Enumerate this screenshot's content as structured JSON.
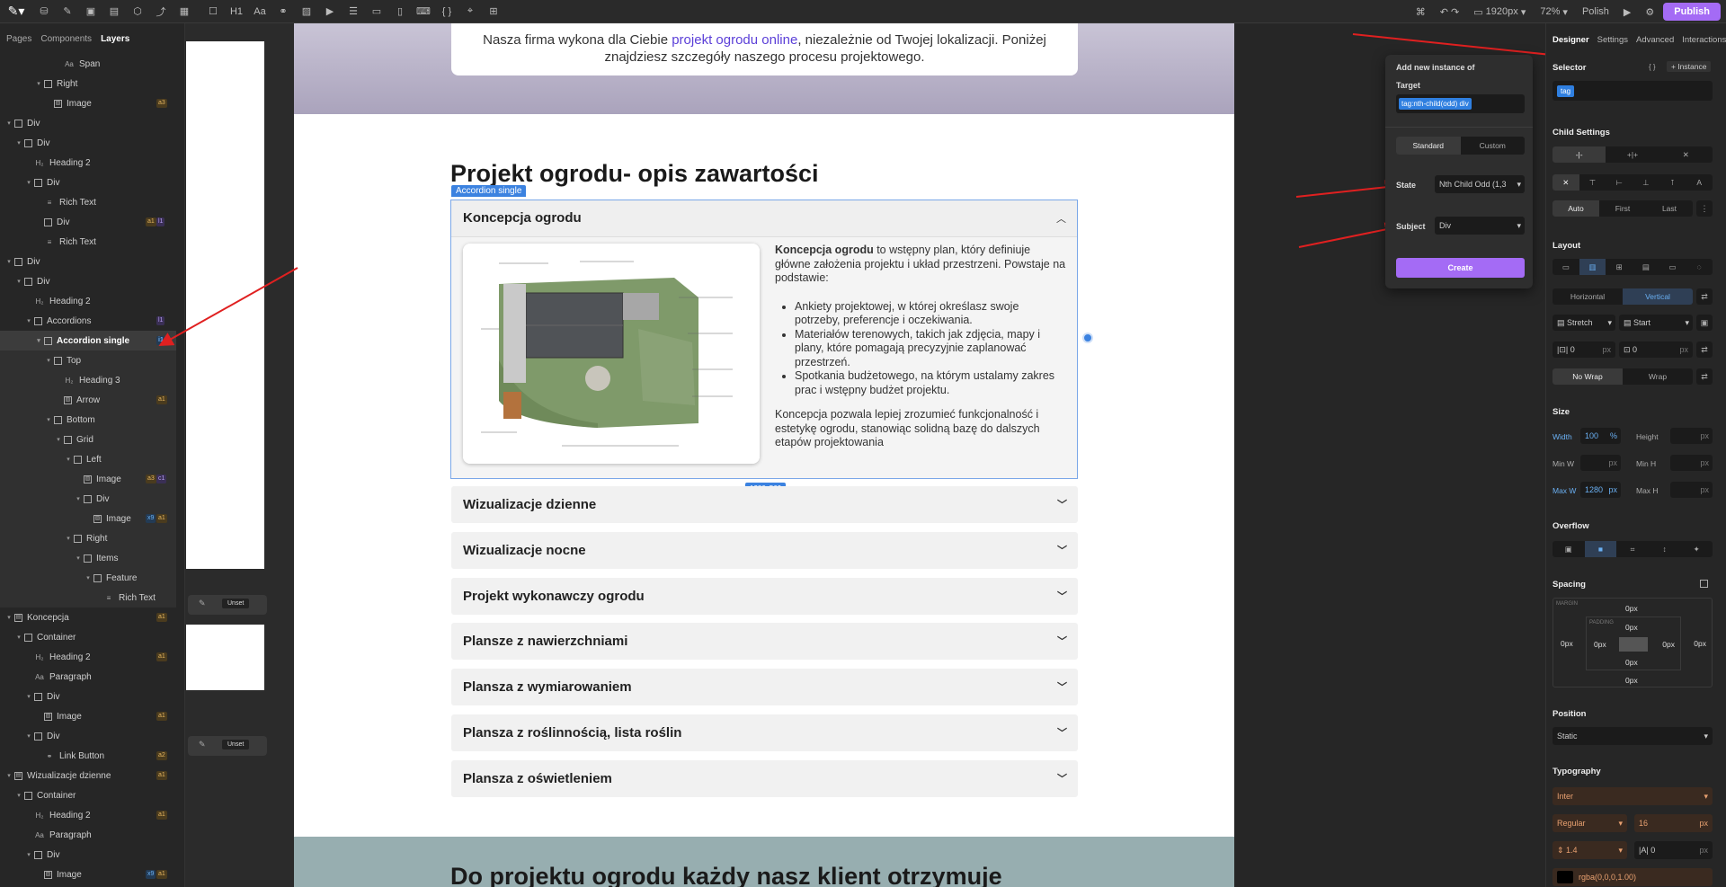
{
  "toolbar": {
    "left_icons": [
      "logo-icon",
      "database-icon",
      "edit-icon",
      "image-icon",
      "book-icon",
      "settings-icon",
      "flow-icon",
      "component-icon",
      "box-icon",
      "heading-icon",
      "text-icon",
      "link-icon",
      "image-icon",
      "video-icon",
      "list-icon",
      "form-icon",
      "form-field-icon",
      "input-icon",
      "code-icon",
      "map-pin-icon",
      "grid-icon"
    ],
    "heading_glyph": "H1",
    "text_glyph": "Aa",
    "code_glyph": "{ }",
    "breakpoint": "1920px",
    "zoom": "72%",
    "polish_label": "Polish",
    "publish_label": "Publish"
  },
  "left_panel": {
    "tabs": [
      "Pages",
      "Components",
      "Layers"
    ],
    "active_tab": "Layers",
    "layers": [
      {
        "label": "Span",
        "depth": 6,
        "icon": "text",
        "caret": false
      },
      {
        "label": "Right",
        "depth": 4,
        "icon": "box",
        "caret": true
      },
      {
        "label": "Image",
        "depth": 5,
        "icon": "image",
        "caret": false,
        "badges": [
          "a3"
        ]
      },
      {
        "label": "Div",
        "depth": 1,
        "icon": "box",
        "caret": true
      },
      {
        "label": "Div",
        "depth": 2,
        "icon": "box",
        "caret": true
      },
      {
        "label": "Heading 2",
        "depth": 3,
        "icon": "heading",
        "caret": false
      },
      {
        "label": "Div",
        "depth": 3,
        "icon": "box",
        "caret": true
      },
      {
        "label": "Rich Text",
        "depth": 4,
        "icon": "rich",
        "caret": false
      },
      {
        "label": "Div",
        "depth": 4,
        "icon": "box",
        "caret": false,
        "badges": [
          "a1",
          "l1"
        ]
      },
      {
        "label": "Rich Text",
        "depth": 4,
        "icon": "rich",
        "caret": false
      },
      {
        "label": "Div",
        "depth": 1,
        "icon": "box",
        "caret": true
      },
      {
        "label": "Div",
        "depth": 2,
        "icon": "box",
        "caret": true
      },
      {
        "label": "Heading 2",
        "depth": 3,
        "icon": "heading",
        "caret": false
      },
      {
        "label": "Accordions",
        "depth": 3,
        "icon": "box",
        "caret": true,
        "badges": [
          "l1"
        ]
      },
      {
        "label": "Accordion single",
        "depth": 4,
        "icon": "box",
        "caret": true,
        "selected": true,
        "badges": [
          "i1"
        ]
      },
      {
        "label": "Top",
        "depth": 5,
        "icon": "box",
        "caret": true
      },
      {
        "label": "Heading 3",
        "depth": 6,
        "icon": "heading",
        "caret": false
      },
      {
        "label": "Arrow",
        "depth": 6,
        "icon": "image",
        "caret": false,
        "badges": [
          "a1"
        ]
      },
      {
        "label": "Bottom",
        "depth": 5,
        "icon": "box",
        "caret": true
      },
      {
        "label": "Grid",
        "depth": 6,
        "icon": "box",
        "caret": true
      },
      {
        "label": "Left",
        "depth": 7,
        "icon": "box",
        "caret": true
      },
      {
        "label": "Image",
        "depth": 8,
        "icon": "image",
        "caret": false,
        "badges": [
          "a3",
          "c1"
        ]
      },
      {
        "label": "Div",
        "depth": 8,
        "icon": "box",
        "caret": true
      },
      {
        "label": "Image",
        "depth": 9,
        "icon": "image",
        "caret": false,
        "badges": [
          "x9",
          "a1"
        ]
      },
      {
        "label": "Right",
        "depth": 7,
        "icon": "box",
        "caret": true
      },
      {
        "label": "Items",
        "depth": 8,
        "icon": "box",
        "caret": true
      },
      {
        "label": "Feature",
        "depth": 9,
        "icon": "box",
        "caret": true
      },
      {
        "label": "Rich Text",
        "depth": 10,
        "icon": "rich",
        "caret": false
      },
      {
        "label": "Koncepcja",
        "depth": 1,
        "icon": "section",
        "caret": true,
        "badges": [
          "a1"
        ]
      },
      {
        "label": "Container",
        "depth": 2,
        "icon": "box",
        "caret": true
      },
      {
        "label": "Heading 2",
        "depth": 3,
        "icon": "heading",
        "caret": false,
        "badges": [
          "a1"
        ]
      },
      {
        "label": "Paragraph",
        "depth": 3,
        "icon": "text",
        "caret": false
      },
      {
        "label": "Div",
        "depth": 3,
        "icon": "box",
        "caret": true
      },
      {
        "label": "Image",
        "depth": 4,
        "icon": "image",
        "caret": false,
        "badges": [
          "a1"
        ]
      },
      {
        "label": "Div",
        "depth": 3,
        "icon": "box",
        "caret": true
      },
      {
        "label": "Link Button",
        "depth": 4,
        "icon": "link",
        "caret": false,
        "badges": [
          "a2"
        ]
      },
      {
        "label": "Wizualizacje dzienne",
        "depth": 1,
        "icon": "section",
        "caret": true,
        "badges": [
          "a1"
        ]
      },
      {
        "label": "Container",
        "depth": 2,
        "icon": "box",
        "caret": true
      },
      {
        "label": "Heading 2",
        "depth": 3,
        "icon": "heading",
        "caret": false,
        "badges": [
          "a1"
        ]
      },
      {
        "label": "Paragraph",
        "depth": 3,
        "icon": "text",
        "caret": false
      },
      {
        "label": "Div",
        "depth": 3,
        "icon": "box",
        "caret": true
      },
      {
        "label": "Image",
        "depth": 4,
        "icon": "image",
        "caret": false,
        "badges": [
          "x9",
          "a1"
        ]
      }
    ]
  },
  "strip": {
    "unset_label": "Unset"
  },
  "canvas": {
    "intro_text_1": "Nasza firma wykona dla Ciebie ",
    "intro_link": "projekt ogrodu online",
    "intro_text_2": ", niezależnie od Twojej lokalizacji. Poniżej",
    "intro_text_3": "znajdziesz szczegóły naszego procesu projektowego.",
    "section_title": "Projekt ogrodu- opis zawartości",
    "selected_badge": "Accordion single",
    "size_badge": "1280x569",
    "open_accordion": {
      "title": "Koncepcja ogrodu",
      "lead_bold": "Koncepcja ogrodu",
      "lead_rest": " to wstępny plan, który definiuje główne założenia projektu i układ przestrzeni. Powstaje na podstawie:",
      "bullets": [
        "Ankiety projektowej, w której określasz swoje potrzeby, preferencje i oczekiwania.",
        "Materiałów terenowych, takich jak zdjęcia, mapy i plany, które pomagają precyzyjnie zaplanować przestrzeń.",
        "Spotkania budżetowego, na którym ustalamy zakres prac i wstępny budżet projektu."
      ],
      "closing": "Koncepcja pozwala lepiej zrozumieć funkcjonalność i estetykę ogrodu, stanowiąc solidną bazę do dalszych etapów projektowania"
    },
    "accordions": [
      "Wizualizacje dzienne",
      "Wizualizacje nocne",
      "Projekt wykonawczy ogrodu",
      "Plansze z nawierzchniami",
      "Plansza z wymiarowaniem",
      "Plansza z roślinnością, lista roślin",
      "Plansza z oświetleniem"
    ],
    "next_title": "Do projektu ogrodu każdy nasz klient otrzymuje"
  },
  "popover": {
    "title": "Add new instance of",
    "target_label": "Target",
    "target_value": "tag:nth-child(odd) div",
    "tabs": [
      "Standard",
      "Custom"
    ],
    "state_label": "State",
    "state_value": "Nth Child Odd (1,3",
    "subject_label": "Subject",
    "subject_value": "Div",
    "create_label": "Create"
  },
  "right_panel": {
    "tabs": [
      "Designer",
      "Settings",
      "Advanced",
      "Interactions"
    ],
    "selector_label": "Selector",
    "instance_label": "+ Instance",
    "code_glyph": "{ }",
    "selector_tag": "tag",
    "child_settings_label": "Child Settings",
    "child_pos": [
      "Auto",
      "First",
      "Last"
    ],
    "layout_label": "Layout",
    "direction": [
      "Horizontal",
      "Vertical"
    ],
    "align": "Stretch",
    "justify": "Start",
    "gap_a": "0",
    "gap_b": "0",
    "px": "px",
    "wrap": [
      "No Wrap",
      "Wrap"
    ],
    "size_label": "Size",
    "width_label": "Width",
    "width_value": "100",
    "width_unit": "%",
    "height_label": "Height",
    "minw_label": "Min W",
    "minh_label": "Min H",
    "maxw_label": "Max W",
    "maxw_value": "1280",
    "maxh_label": "Max H",
    "overflow_label": "Overflow",
    "spacing_label": "Spacing",
    "margin_label": "MARGIN",
    "padding_label": "PADDING",
    "zero": "0px",
    "position_label": "Position",
    "position_value": "Static",
    "typography_label": "Typography",
    "font_value": "Inter",
    "weight_value": "Regular",
    "size_value": "16",
    "line_height": "1.4",
    "letter_spacing": "0",
    "color_value": "rgba(0,0,0,1.00)"
  },
  "colors": {
    "accent": "#a46bf5",
    "selection": "#3b82e0",
    "arrow": "#e02020"
  }
}
